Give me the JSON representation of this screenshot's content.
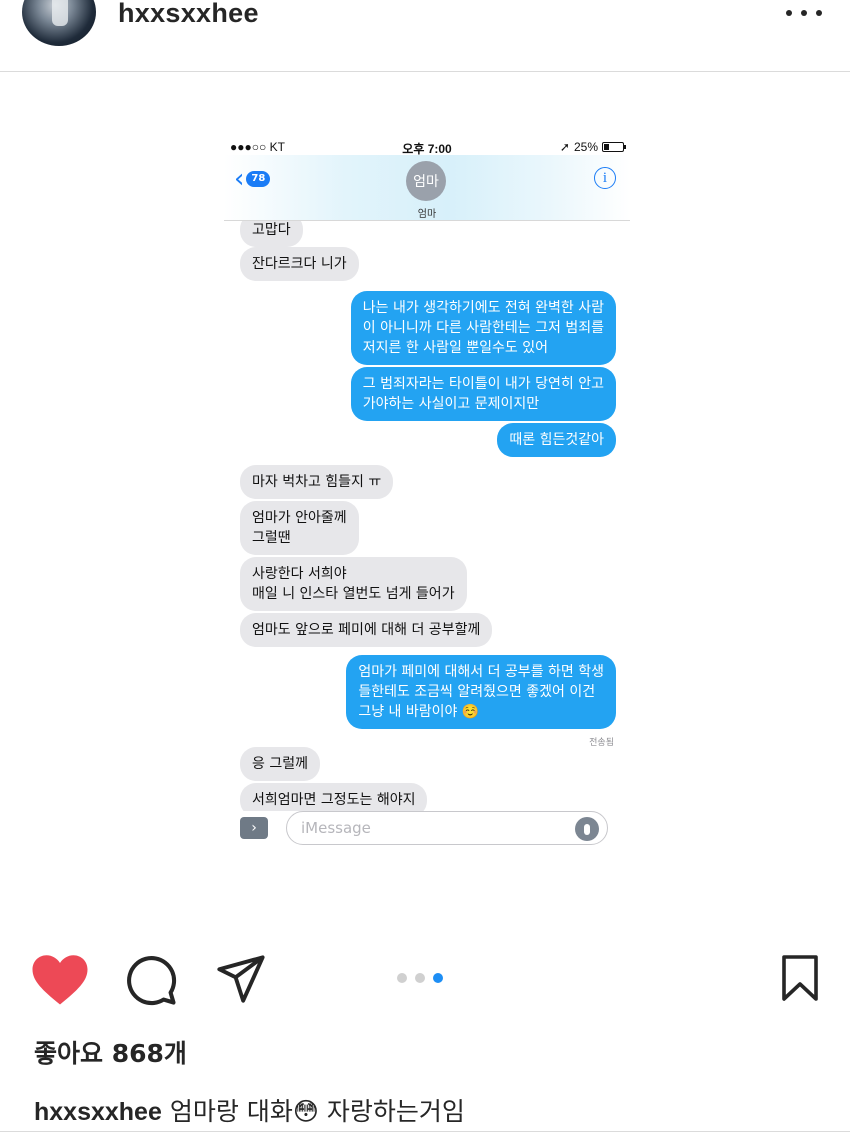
{
  "post": {
    "username": "hxxsxxhee",
    "likes_text": "좋아요 868개",
    "caption_user": "hxxsxxhee",
    "caption_text": "엄마랑 대화😳  자랑하는거임",
    "carousel": {
      "count": 3,
      "active_index": 2
    }
  },
  "phone": {
    "status": {
      "carrier": "●●●○○ KT",
      "time": "오후 7:00",
      "battery": "25%"
    },
    "nav": {
      "back_chevron": "‹",
      "unread_count": "78",
      "contact_avatar": "엄마",
      "contact_name": "엄마",
      "info": "i"
    },
    "messages": [
      {
        "from": "them",
        "text": "고맙다"
      },
      {
        "from": "them",
        "text": "잔다르크다 니가"
      },
      {
        "from": "me",
        "text": "나는 내가 생각하기에도 전혀 완벽한 사람\n이 아니니까 다른 사람한테는 그저 범죄를\n저지른 한 사람일 뿐일수도 있어"
      },
      {
        "from": "me",
        "text": "그 범죄자라는 타이틀이 내가 당연히 안고\n가야하는 사실이고 문제이지만"
      },
      {
        "from": "me",
        "text": "때론 힘든것같아"
      },
      {
        "from": "them",
        "text": "마자 벅차고 힘들지 ㅠ"
      },
      {
        "from": "them",
        "text": "엄마가 안아줄께\n그럴땐"
      },
      {
        "from": "them",
        "text": "사랑한다 서희야\n매일 니 인스타 열번도 넘게 들어가"
      },
      {
        "from": "them",
        "text": "엄마도 앞으로 페미에 대해 더 공부할께"
      },
      {
        "from": "me",
        "text": "엄마가 페미에 대해서 더 공부를 하면 학생\n들한테도 조금씩 알려줬으면 좋겠어 이건\n그냥 내 바람이야 ☺️"
      },
      {
        "from": "them",
        "text": "응 그럴께"
      },
      {
        "from": "them",
        "text": "서희엄마면 그정도는 해야지"
      }
    ],
    "delivered": "전송됨",
    "composer": {
      "camera": "›",
      "placeholder": "iMessage"
    }
  },
  "colors": {
    "sent": "#23a3f2",
    "received": "#e7e7ea",
    "like": "#ed4956",
    "active_dot": "#1d8ef5"
  },
  "icons": [
    "heart-icon",
    "comment-icon",
    "share-icon",
    "bookmark-icon",
    "more-icon",
    "info-icon",
    "mic-icon"
  ]
}
